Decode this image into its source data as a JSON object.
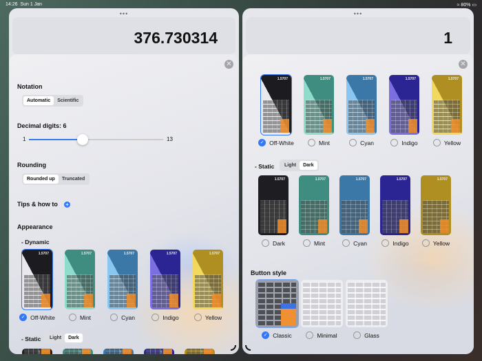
{
  "status": {
    "time": "14:26",
    "date": "Sun 1 Jan",
    "battery": "80%"
  },
  "left": {
    "display": "376.730314",
    "notation": {
      "label": "Notation",
      "options": [
        "Automatic",
        "Scientific"
      ],
      "selected": 0
    },
    "decimal": {
      "label": "Decimal digits: 6",
      "min": "1",
      "max": "13",
      "value": 6
    },
    "rounding": {
      "label": "Rounding",
      "options": [
        "Rounded up",
        "Truncated"
      ],
      "selected": 0
    },
    "tips": {
      "label": "Tips & how to"
    },
    "appearance": {
      "label": "Appearance",
      "dynamic": "- Dynamic",
      "static": "- Static",
      "static_options": [
        "Light",
        "Dark"
      ],
      "static_selected": 1
    }
  },
  "right": {
    "display": "1",
    "static": "- Static",
    "static_options": [
      "Light",
      "Dark"
    ],
    "static_selected": 1,
    "button_style": {
      "label": "Button style",
      "options": [
        "Classic",
        "Minimal",
        "Glass"
      ],
      "selected": 0
    }
  },
  "themes": [
    {
      "name": "Off-White",
      "light": "#e8e8ee",
      "dark": "#1c1c20"
    },
    {
      "name": "Mint",
      "light": "#8fdccc",
      "dark": "#3f8c80"
    },
    {
      "name": "Cyan",
      "light": "#8ac6f0",
      "dark": "#3b78a8"
    },
    {
      "name": "Indigo",
      "light": "#7a6ee0",
      "dark": "#2b2594"
    },
    {
      "name": "Yellow",
      "light": "#f2d95e",
      "dark": "#b08f22"
    }
  ],
  "static_themes": [
    {
      "name": "Dark",
      "color": "#1e1e22"
    },
    {
      "name": "Mint",
      "color": "#3f8c80"
    },
    {
      "name": "Cyan",
      "color": "#3b78a8"
    },
    {
      "name": "Indigo",
      "color": "#2b2594"
    },
    {
      "name": "Yellow",
      "color": "#b08f22"
    }
  ],
  "selected_theme": 0,
  "thumb_value": "1.5707"
}
